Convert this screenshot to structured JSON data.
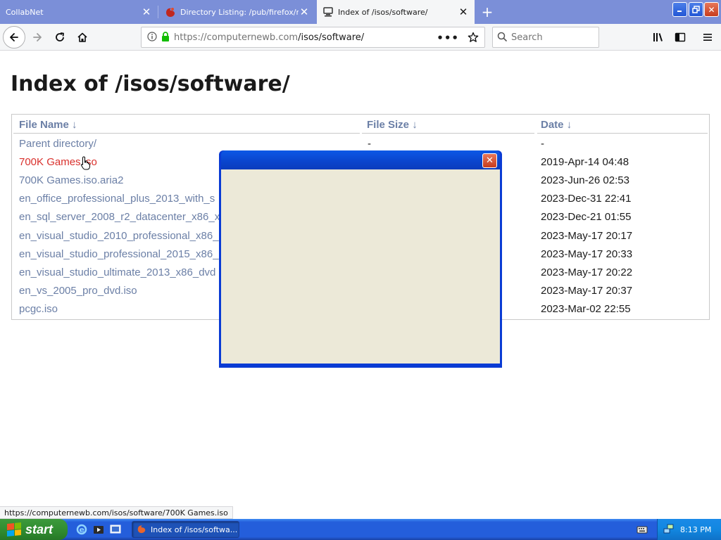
{
  "tabs": [
    {
      "title": "CollabNet",
      "active": false
    },
    {
      "title": "Directory Listing: /pub/firefox/nig",
      "active": false
    },
    {
      "title": "Index of /isos/software/",
      "active": true
    }
  ],
  "toolbar": {
    "url_host": "https://computernewb.com",
    "url_path": "/isos/software/",
    "search_placeholder": "Search"
  },
  "page": {
    "title": "Index of /isos/software/",
    "columns": [
      "File Name ↓",
      "File Size ↓",
      "Date ↓"
    ],
    "rows": [
      {
        "name": "Parent directory/",
        "size": "-",
        "date": "-"
      },
      {
        "name": "700K Games.iso",
        "size": "",
        "date": "2019-Apr-14 04:48"
      },
      {
        "name": "700K Games.iso.aria2",
        "size": "",
        "date": "2023-Jun-26 02:53"
      },
      {
        "name": "en_office_professional_plus_2013_with_s",
        "size": "",
        "date": "2023-Dec-31 22:41"
      },
      {
        "name": "en_sql_server_2008_r2_datacenter_x86_x",
        "size": "",
        "date": "2023-Dec-21 01:55"
      },
      {
        "name": "en_visual_studio_2010_professional_x86_",
        "size": "",
        "date": "2023-May-17 20:17"
      },
      {
        "name": "en_visual_studio_professional_2015_x86_",
        "size": "",
        "date": "2023-May-17 20:33"
      },
      {
        "name": "en_visual_studio_ultimate_2013_x86_dvd",
        "size": "",
        "date": "2023-May-17 20:22"
      },
      {
        "name": "en_vs_2005_pro_dvd.iso",
        "size": "",
        "date": "2023-May-17 20:37"
      },
      {
        "name": "pcgc.iso",
        "size": "",
        "date": "2023-Mar-02 22:55"
      }
    ]
  },
  "status_url": "https://computernewb.com/isos/software/700K Games.iso",
  "taskbar": {
    "start_label": "start",
    "task_label": "Index of /isos/softwa...",
    "clock": "8:13 PM"
  },
  "colors": {
    "link": "#6b7fa6",
    "link_hover": "#d9302c",
    "tabstrip": "#7b8fd8",
    "taskbar": "#245edb",
    "dialog_body": "#ece9d8"
  }
}
